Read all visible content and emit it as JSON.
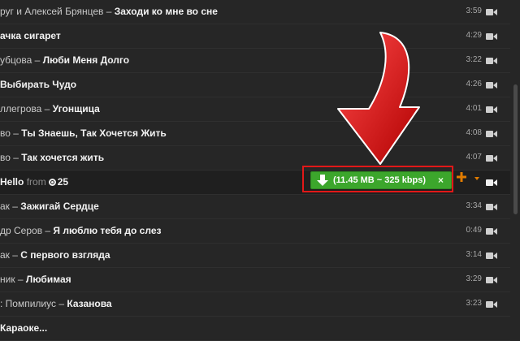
{
  "tracks": [
    {
      "artist": "руг и Алексей Брянцев – ",
      "title": "Заходи ко мне во сне",
      "duration": "3:59"
    },
    {
      "artist": "",
      "title": "ачка сигарет",
      "duration": "4:29"
    },
    {
      "artist": "убцова – ",
      "title": "Люби Меня Долго",
      "duration": "3:22"
    },
    {
      "artist": "",
      "title": "Выбирать Чудо",
      "duration": "4:26"
    },
    {
      "artist": "ллегрова – ",
      "title": "Угонщица",
      "duration": "4:01"
    },
    {
      "artist": "во – ",
      "title": "Ты Знаешь, Так Хочется Жить",
      "duration": "4:08"
    },
    {
      "artist": "во – ",
      "title": "Так хочется жить",
      "duration": "4:07"
    },
    {
      "artist": "",
      "title": "",
      "duration": ""
    },
    {
      "artist": "ак – ",
      "title": "Зажигай Сердце",
      "duration": "3:34"
    },
    {
      "artist": "др Серов – ",
      "title": "Я люблю тебя до слез",
      "duration": "0:49"
    },
    {
      "artist": "ак – ",
      "title": "С первого взгляда",
      "duration": "3:14"
    },
    {
      "artist": "ник – ",
      "title": "Любимая",
      "duration": "3:29"
    },
    {
      "artist": ": Помпилиус – ",
      "title": "Казанова",
      "duration": "3:23"
    },
    {
      "artist": "",
      "title": "Караоке...",
      "duration": ""
    }
  ],
  "active_track": {
    "title": "Hello",
    "from_label": "from",
    "count": "25"
  },
  "download": {
    "label": "(11.45 MB ~ 325 kbps)",
    "close_glyph": "×"
  },
  "colors": {
    "background": "#262626",
    "download_green": "#3ca62c",
    "highlight_red": "#e21818",
    "accent_orange": "#e07b00"
  },
  "icons": [
    "video-icon",
    "ok-icon",
    "download-arrow-icon",
    "close-icon",
    "plus-icon",
    "caret-down-icon",
    "scrollbar"
  ]
}
